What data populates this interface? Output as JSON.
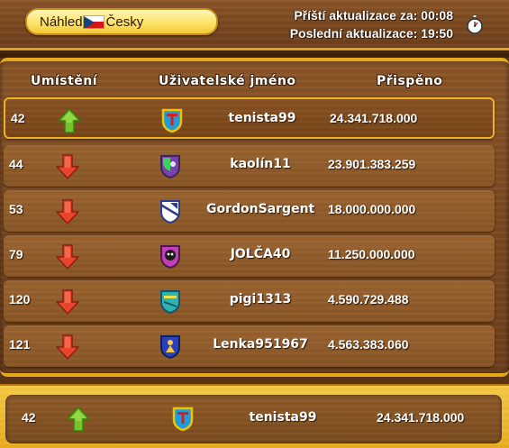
{
  "top_bar": {
    "preview_label": "Náhled",
    "language_label": "Česky",
    "next_update": "Příští aktualizace za: 00:08",
    "last_update": "Poslední aktualizace: 19:50",
    "stopwatch_icon": "stopwatch-icon"
  },
  "table": {
    "headers": {
      "rank": "Umístění",
      "username": "Uživatelské jméno",
      "contributed": "Přispěno"
    },
    "rows": [
      {
        "rank": "42",
        "trend": "up",
        "username": "tenista99",
        "contributed": "24.341.718.000",
        "avatar": "shield-T-icon"
      },
      {
        "rank": "44",
        "trend": "down",
        "username": "kaolín11",
        "contributed": "23.901.383.259",
        "avatar": "shield-green-purple-icon"
      },
      {
        "rank": "53",
        "trend": "down",
        "username": "GordonSargent",
        "contributed": "18.000.000.000",
        "avatar": "shield-blue-white-icon"
      },
      {
        "rank": "79",
        "trend": "down",
        "username": "JOLČA40",
        "contributed": "11.250.000.000",
        "avatar": "shield-skull-icon"
      },
      {
        "rank": "120",
        "trend": "down",
        "username": "pigi1313",
        "contributed": "4.590.729.488",
        "avatar": "shield-teal-icon"
      },
      {
        "rank": "121",
        "trend": "down",
        "username": "Lenka951967",
        "contributed": "4.563.383.060",
        "avatar": "shield-blue-figure-icon"
      }
    ]
  },
  "footer": {
    "rank": "42",
    "trend": "up",
    "username": "tenista99",
    "contributed": "24.341.718.000",
    "avatar": "shield-T-icon"
  },
  "colors": {
    "wood": "#7a4820",
    "gold_border": "#e6a91c",
    "up_arrow": "#6fc22a",
    "down_arrow": "#e8402a"
  }
}
